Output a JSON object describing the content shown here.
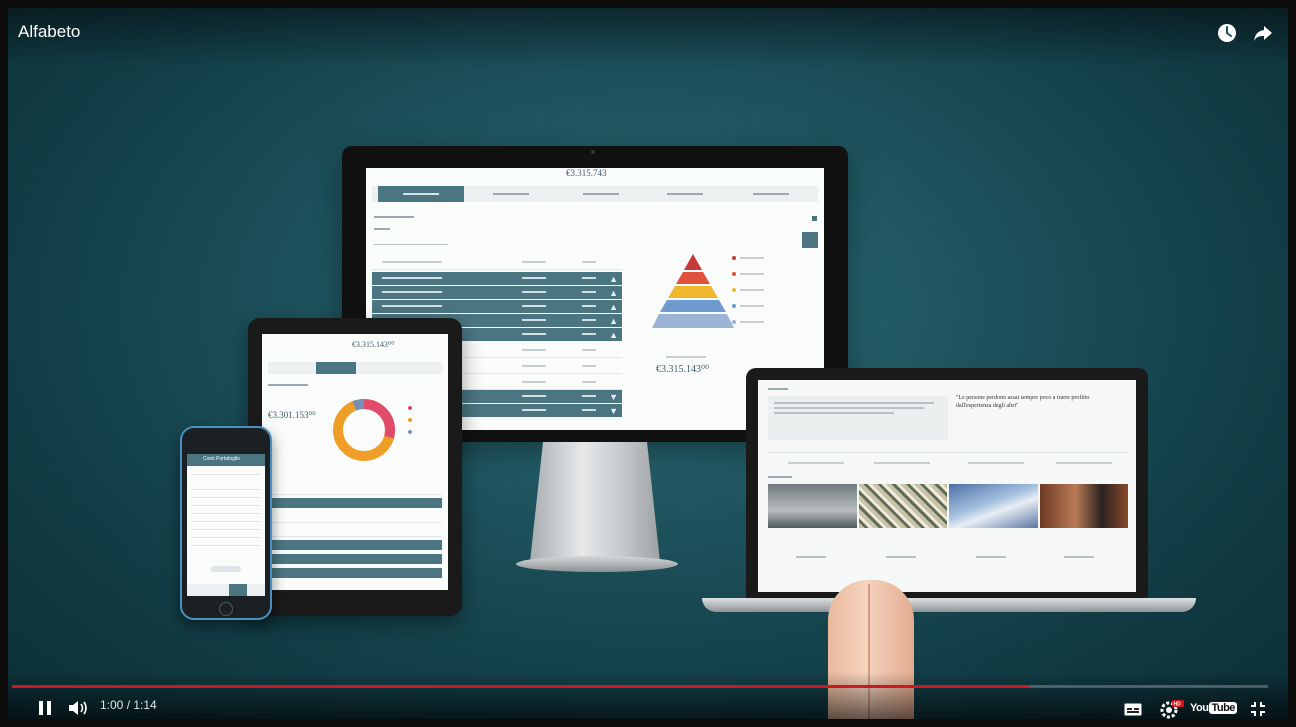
{
  "video": {
    "title": "Alfabeto",
    "current_time": "1:00",
    "duration": "1:14",
    "time_separator": " / ",
    "progress_fraction": 0.81
  },
  "screens": {
    "monitor_heading": "€3.315.743",
    "monitor_amount": "€3.315.143⁰⁰",
    "tablet_amount": "€3.315.143⁰⁰",
    "tablet_amount_2": "€3.301.153⁰⁰",
    "laptop_quote": "\"Le persone perdono assai sempre poco a trarre profitto dall'esperienza degli altri\"",
    "phone_title": "Conti Portafoglio"
  },
  "colors": {
    "accent_red": "#cc181e",
    "panel_teal": "#4b7580",
    "background_teal": "#1d525c"
  },
  "icons": {
    "clock": "clock-icon",
    "share": "share-icon",
    "pause": "pause-icon",
    "volume": "volume-icon",
    "subtitles": "subtitles-icon",
    "settings": "settings-icon",
    "youtube": "youtube-logo",
    "exit_fullscreen": "exit-fullscreen-icon"
  },
  "youtube_logo_text": "YouTube"
}
